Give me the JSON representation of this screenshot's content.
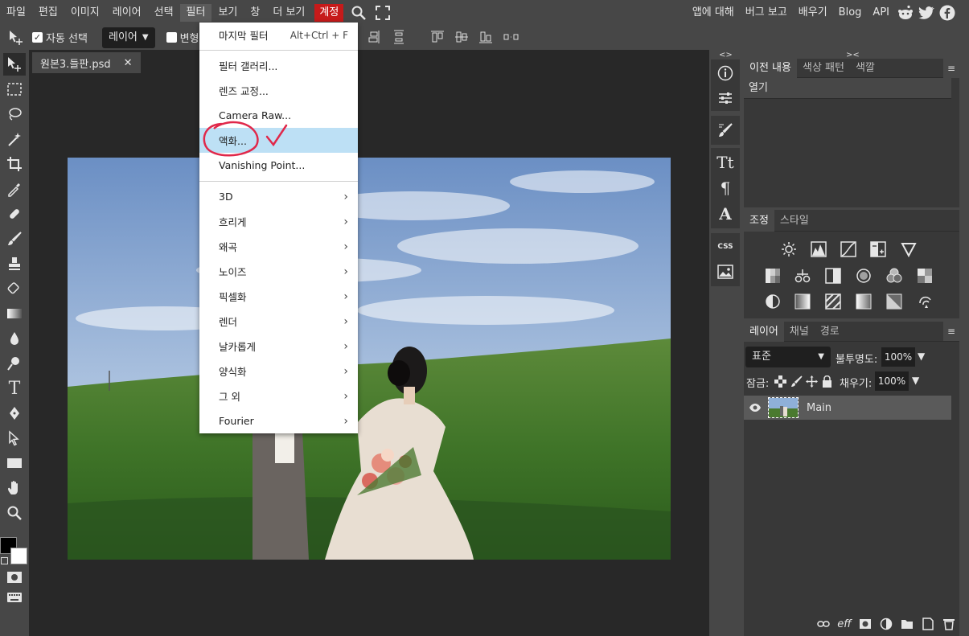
{
  "menubar": {
    "items": [
      "파일",
      "편집",
      "이미지",
      "레이어",
      "선택",
      "필터",
      "보기",
      "창",
      "더 보기"
    ],
    "account": "계정",
    "right_links": [
      "앱에 대해",
      "버그 보고",
      "배우기",
      "Blog",
      "API"
    ],
    "accent": "#c61a1a"
  },
  "options": {
    "auto_select_label": "자동 선택",
    "auto_select_checked": true,
    "layer_select_value": "레이어",
    "transform_label": "변형"
  },
  "document": {
    "tab_title": "원본3.들판.psd",
    "close_glyph": "✕"
  },
  "filter_menu": {
    "items": [
      {
        "label": "마지막 필터",
        "shortcut": "Alt+Ctrl + F"
      },
      {
        "label": "필터 갤러리..."
      },
      {
        "label": "렌즈 교정..."
      },
      {
        "label": "Camera Raw..."
      },
      {
        "label": "액화...",
        "highlighted": true
      },
      {
        "label": "Vanishing Point..."
      },
      {
        "label": "3D",
        "submenu": true
      },
      {
        "label": "흐리게",
        "submenu": true
      },
      {
        "label": "왜곡",
        "submenu": true
      },
      {
        "label": "노이즈",
        "submenu": true
      },
      {
        "label": "픽셀화",
        "submenu": true
      },
      {
        "label": "렌더",
        "submenu": true
      },
      {
        "label": "날카롭게",
        "submenu": true
      },
      {
        "label": "양식화",
        "submenu": true
      },
      {
        "label": "그 외",
        "submenu": true
      },
      {
        "label": "Fourier",
        "submenu": true
      }
    ],
    "highlight_color": "#bde0f5",
    "annotation_color": "#e0284a"
  },
  "side_toggles": {
    "left": "<>",
    "right": "><"
  },
  "history_panel": {
    "tabs": [
      "이전 내용",
      "색상 패턴",
      "색깔"
    ],
    "active_tab": "이전 내용",
    "entries": [
      "열기"
    ]
  },
  "adjust_panel": {
    "tabs": [
      "조정",
      "스타일"
    ],
    "active_tab": "조정"
  },
  "layers_panel": {
    "tabs": [
      "레이어",
      "채널",
      "경로"
    ],
    "active_tab": "레이어",
    "blend_mode": "표준",
    "opacity_label": "불투명도:",
    "opacity_value": "100%",
    "lock_label": "잠금:",
    "fill_label": "채우기:",
    "fill_value": "100%",
    "layers": [
      {
        "name": "Main",
        "visible": true
      }
    ]
  },
  "iconcol": {
    "css_label": "CSS"
  },
  "bottom_bar": {
    "eff_label": "eff"
  }
}
